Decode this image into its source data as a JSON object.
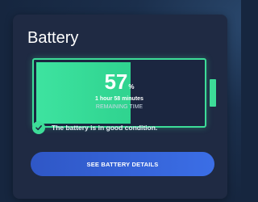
{
  "battery_card": {
    "title": "Battery",
    "level_percent": 57,
    "percent_value": "57",
    "percent_unit": "%",
    "time_remaining": "1 hour 58 minutes",
    "remaining_label": "REMAINING TIME",
    "status_text": "The battery is in good condition.",
    "details_button_label": "SEE BATTERY DETAILS"
  },
  "colors": {
    "accent_green": "#3ddc98",
    "button_blue": "#3b6ee6",
    "card_bg": "#1f2a43"
  }
}
